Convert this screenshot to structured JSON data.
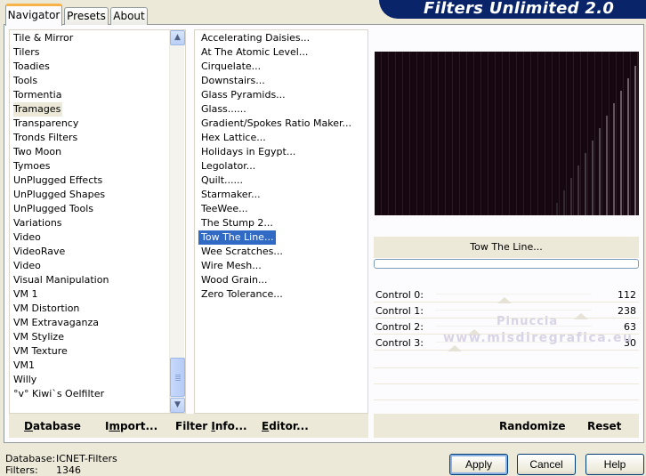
{
  "tabs": [
    {
      "label": "Navigator",
      "active": true
    },
    {
      "label": "Presets",
      "active": false
    },
    {
      "label": "About",
      "active": false
    }
  ],
  "banner_title": "Filters Unlimited 2.0",
  "colors": {
    "selection": "#316ac5",
    "banner": "#0a246a",
    "dialog_bg": "#ece9d8"
  },
  "categories": [
    {
      "label": "Tile & Mirror"
    },
    {
      "label": "Tilers"
    },
    {
      "label": "Toadies"
    },
    {
      "label": "Tools"
    },
    {
      "label": "Tormentia"
    },
    {
      "label": "Tramages",
      "selected": true
    },
    {
      "label": "Transparency"
    },
    {
      "label": "Tronds Filters"
    },
    {
      "label": "Two Moon"
    },
    {
      "label": "Tymoes"
    },
    {
      "label": "UnPlugged Effects"
    },
    {
      "label": "UnPlugged Shapes"
    },
    {
      "label": "UnPlugged Tools"
    },
    {
      "label": "Variations"
    },
    {
      "label": "Video"
    },
    {
      "label": "VideoRave"
    },
    {
      "label": "Video"
    },
    {
      "label": "Visual Manipulation"
    },
    {
      "label": "VM 1"
    },
    {
      "label": "VM Distortion"
    },
    {
      "label": "VM Extravaganza"
    },
    {
      "label": "VM Stylize"
    },
    {
      "label": "VM Texture"
    },
    {
      "label": "VM1"
    },
    {
      "label": "Willy"
    },
    {
      "label": "°v° Kiwi`s Oelfilter"
    }
  ],
  "filters": [
    {
      "label": "Accelerating Daisies..."
    },
    {
      "label": "At The Atomic Level..."
    },
    {
      "label": "Cirquelate..."
    },
    {
      "label": "Downstairs..."
    },
    {
      "label": "Glass Pyramids..."
    },
    {
      "label": "Glass......"
    },
    {
      "label": "Gradient/Spokes Ratio Maker..."
    },
    {
      "label": "Hex Lattice..."
    },
    {
      "label": "Holidays in Egypt..."
    },
    {
      "label": "Legolator..."
    },
    {
      "label": "Quilt......"
    },
    {
      "label": "Starmaker..."
    },
    {
      "label": "TeeWee..."
    },
    {
      "label": "The Stump 2..."
    },
    {
      "label": "Tow The Line...",
      "selected": true
    },
    {
      "label": "Wee Scratches..."
    },
    {
      "label": "Wire Mesh..."
    },
    {
      "label": "Wood Grain..."
    },
    {
      "label": "Zero Tolerance..."
    }
  ],
  "left_buttons": {
    "database": {
      "u": "D",
      "rest": "atabase"
    },
    "import": {
      "pre": "I",
      "u": "m",
      "rest": "port..."
    },
    "filter_info": {
      "pre": "Filter ",
      "u": "I",
      "rest": "nfo..."
    },
    "editor": {
      "u": "E",
      "rest": "ditor..."
    }
  },
  "preview_filter_name": "Tow The Line...",
  "progress": 0,
  "controls": [
    {
      "label": "Control 0:",
      "value": 112
    },
    {
      "label": "Control 1:",
      "value": 238
    },
    {
      "label": "Control 2:",
      "value": 63
    },
    {
      "label": "Control 3:",
      "value": 30
    }
  ],
  "slider_max": 255,
  "watermark": {
    "line1": "Pinuccia",
    "line2": "www.misdiregrafica.eu"
  },
  "right_buttons": {
    "randomize": "Randomize",
    "reset": "Reset"
  },
  "status": {
    "database_label": "Database:",
    "database_value": "ICNET-Filters",
    "filters_label": "Filters:",
    "filters_value": "1346"
  },
  "dialog_buttons": {
    "apply": "Apply",
    "cancel": "Cancel",
    "help": "Help"
  }
}
